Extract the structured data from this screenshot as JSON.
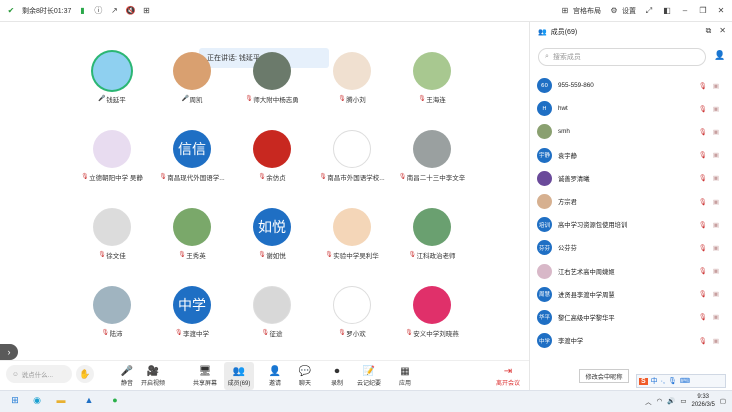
{
  "topbar": {
    "remaining": "剩余8时长01:37",
    "layout_label": "宫格布局",
    "settings_label": "设置"
  },
  "speaking": "正在讲话: 钱延平",
  "participants": [
    {
      "name": "钱延平",
      "avatar_text": "",
      "avatar_color": "#8fd0f0",
      "mic": "on"
    },
    {
      "name": "周凯",
      "avatar_text": "",
      "avatar_color": "#d9a070",
      "mic": "on"
    },
    {
      "name": "师大附中杨志勇",
      "avatar_text": "",
      "avatar_color": "#6b7a6b",
      "mic": "muted"
    },
    {
      "name": "腾小刘",
      "avatar_text": "",
      "avatar_color": "#f0e0d0",
      "mic": "muted"
    },
    {
      "name": "王海连",
      "avatar_text": "",
      "avatar_color": "#a8c890",
      "mic": "muted"
    },
    {
      "name": "立德朝阳中学 吴静",
      "avatar_text": "",
      "avatar_color": "#e8dcf0",
      "mic": "muted"
    },
    {
      "name": "南昌现代外国语学...",
      "avatar_text": "信信",
      "avatar_color": "#1f6fc4",
      "mic": "muted"
    },
    {
      "name": "余仿贞",
      "avatar_text": "",
      "avatar_color": "#c82820",
      "mic": "muted"
    },
    {
      "name": "南昌市外国语学校...",
      "avatar_text": "",
      "avatar_color": "#ffffff",
      "mic": "muted"
    },
    {
      "name": "南昌二十三中李文辛",
      "avatar_text": "",
      "avatar_color": "#9aa0a0",
      "mic": "muted"
    },
    {
      "name": "徐文佳",
      "avatar_text": "",
      "avatar_color": "#dcdcdc",
      "mic": "muted"
    },
    {
      "name": "王秀英",
      "avatar_text": "",
      "avatar_color": "#7aa86a",
      "mic": "muted"
    },
    {
      "name": "谢如悦",
      "avatar_text": "如悦",
      "avatar_color": "#1f6fc4",
      "mic": "muted"
    },
    {
      "name": "实验中学吴利华",
      "avatar_text": "",
      "avatar_color": "#f4d6b8",
      "mic": "muted"
    },
    {
      "name": "江科政治老师",
      "avatar_text": "",
      "avatar_color": "#6aa070",
      "mic": "muted"
    },
    {
      "name": "陆沛",
      "avatar_text": "",
      "avatar_color": "#a0b4c0",
      "mic": "muted"
    },
    {
      "name": "李渡中学",
      "avatar_text": "中学",
      "avatar_color": "#1f6fc4",
      "mic": "muted"
    },
    {
      "name": "征途",
      "avatar_text": "",
      "avatar_color": "#d8d8d8",
      "mic": "muted"
    },
    {
      "name": "罗小欢",
      "avatar_text": "",
      "avatar_color": "#ffffff",
      "mic": "muted"
    },
    {
      "name": "安义中学刘晓燕",
      "avatar_text": "",
      "avatar_color": "#e0306a",
      "mic": "muted"
    }
  ],
  "chat_placeholder": "说点什么...",
  "toolbar": [
    {
      "name": "mute",
      "label": "静音",
      "icon": "🎤"
    },
    {
      "name": "video",
      "label": "开启视频",
      "icon": "🎥"
    },
    {
      "name": "share",
      "label": "共享屏幕",
      "icon": "🖥"
    },
    {
      "name": "members",
      "label": "成员(69)",
      "icon": "👥"
    },
    {
      "name": "invite",
      "label": "邀请",
      "icon": "👤"
    },
    {
      "name": "chat",
      "label": "聊天",
      "icon": "💬"
    },
    {
      "name": "record",
      "label": "录制",
      "icon": "⏺"
    },
    {
      "name": "minutes",
      "label": "云记纪要",
      "icon": "📝"
    },
    {
      "name": "apps",
      "label": "应用",
      "icon": "▦"
    }
  ],
  "leave_label": "离开会议",
  "panel": {
    "title": "成员(69)",
    "search_placeholder": "搜索成员"
  },
  "members": [
    {
      "name": "955-559-860",
      "avatar_text": "60",
      "color": "#1f6fc4"
    },
    {
      "name": "hwt",
      "avatar_text": "H",
      "color": "#1f6fc4"
    },
    {
      "name": "smh",
      "avatar_text": "",
      "color": "#8aa070"
    },
    {
      "name": "袁宇静",
      "avatar_text": "宇静",
      "color": "#1f6fc4"
    },
    {
      "name": "诚善罗清曦",
      "avatar_text": "",
      "color": "#6a4a9a"
    },
    {
      "name": "方宗君",
      "avatar_text": "",
      "color": "#d6b090"
    },
    {
      "name": "高中学习资源包使用培训",
      "avatar_text": "培训",
      "color": "#1f6fc4"
    },
    {
      "name": "公芬芬",
      "avatar_text": "芬芬",
      "color": "#1f6fc4"
    },
    {
      "name": "江右艺术高中周婕姬",
      "avatar_text": "",
      "color": "#d8b8c8"
    },
    {
      "name": "进贤县李渡中学周慧",
      "avatar_text": "周慧",
      "color": "#1f6fc4"
    },
    {
      "name": "黎仁高级中学黎华平",
      "avatar_text": "华平",
      "color": "#1f6fc4"
    },
    {
      "name": "李渡中学",
      "avatar_text": "中学",
      "color": "#1f6fc4"
    }
  ],
  "tooltip": "修改会中昵称",
  "ime": {
    "char": "中",
    "logo": "S"
  },
  "clock": {
    "time": "9:33",
    "date": "2026/3/5"
  }
}
